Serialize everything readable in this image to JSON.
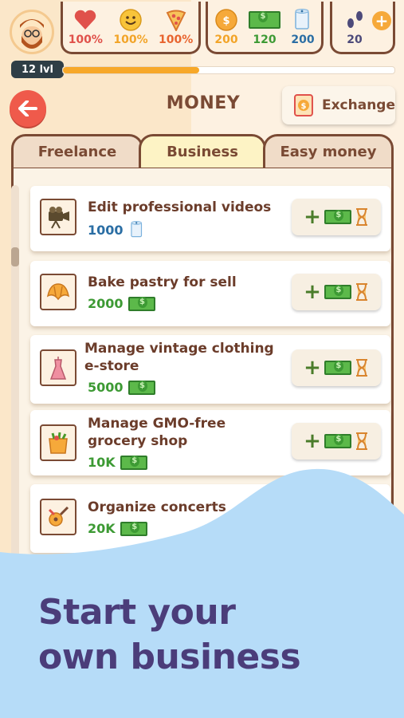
{
  "player": {
    "level": "12 lvl",
    "level_progress": 0.41
  },
  "stats_needs": [
    {
      "icon": "heart-icon",
      "value": "100%",
      "color": "#e0514b"
    },
    {
      "icon": "smile-icon",
      "value": "100%",
      "color": "#f2a428"
    },
    {
      "icon": "pizza-icon",
      "value": "100%",
      "color": "#e8642f"
    }
  ],
  "stats_currency": [
    {
      "icon": "coin-icon",
      "value": "200",
      "color": "#f2a428"
    },
    {
      "icon": "cash-icon",
      "value": "120",
      "color": "#3d9a34"
    },
    {
      "icon": "toilet-paper-icon",
      "value": "200",
      "color": "#2b6ea4"
    }
  ],
  "stats_steps": {
    "icon": "footprints-icon",
    "value": "20"
  },
  "header": {
    "title": "MONEY",
    "exchange_label": "Exchange"
  },
  "tabs": [
    {
      "label": "Freelance",
      "active": false
    },
    {
      "label": "Business",
      "active": true
    },
    {
      "label": "Easy money",
      "active": false
    }
  ],
  "jobs": [
    {
      "title": "Edit professional videos",
      "price": "1000",
      "price_color": "#2b6ea4",
      "currency_icon": "toilet-paper-icon",
      "icon": "camera-icon"
    },
    {
      "title": "Bake pastry for sell",
      "price": "2000",
      "price_color": "#3d9a34",
      "currency_icon": "cash-icon",
      "icon": "croissant-icon"
    },
    {
      "title": "Manage vintage clothing e-store",
      "price": "5000",
      "price_color": "#3d9a34",
      "currency_icon": "cash-icon",
      "icon": "dress-icon"
    },
    {
      "title": "Manage GMO-free grocery shop",
      "price": "10K",
      "price_color": "#3d9a34",
      "currency_icon": "cash-icon",
      "icon": "grocery-bag-icon"
    },
    {
      "title": "Organize concerts",
      "price": "20K",
      "price_color": "#3d9a34",
      "currency_icon": "cash-icon",
      "icon": "guitar-icon"
    }
  ],
  "action": {
    "plus": "+"
  },
  "promo": {
    "line1": "Start your",
    "line2": "own business"
  },
  "colors": {
    "wave": "#b6dcf8",
    "promo_text": "#4b3d7a",
    "accent_brown": "#7a4a34"
  }
}
